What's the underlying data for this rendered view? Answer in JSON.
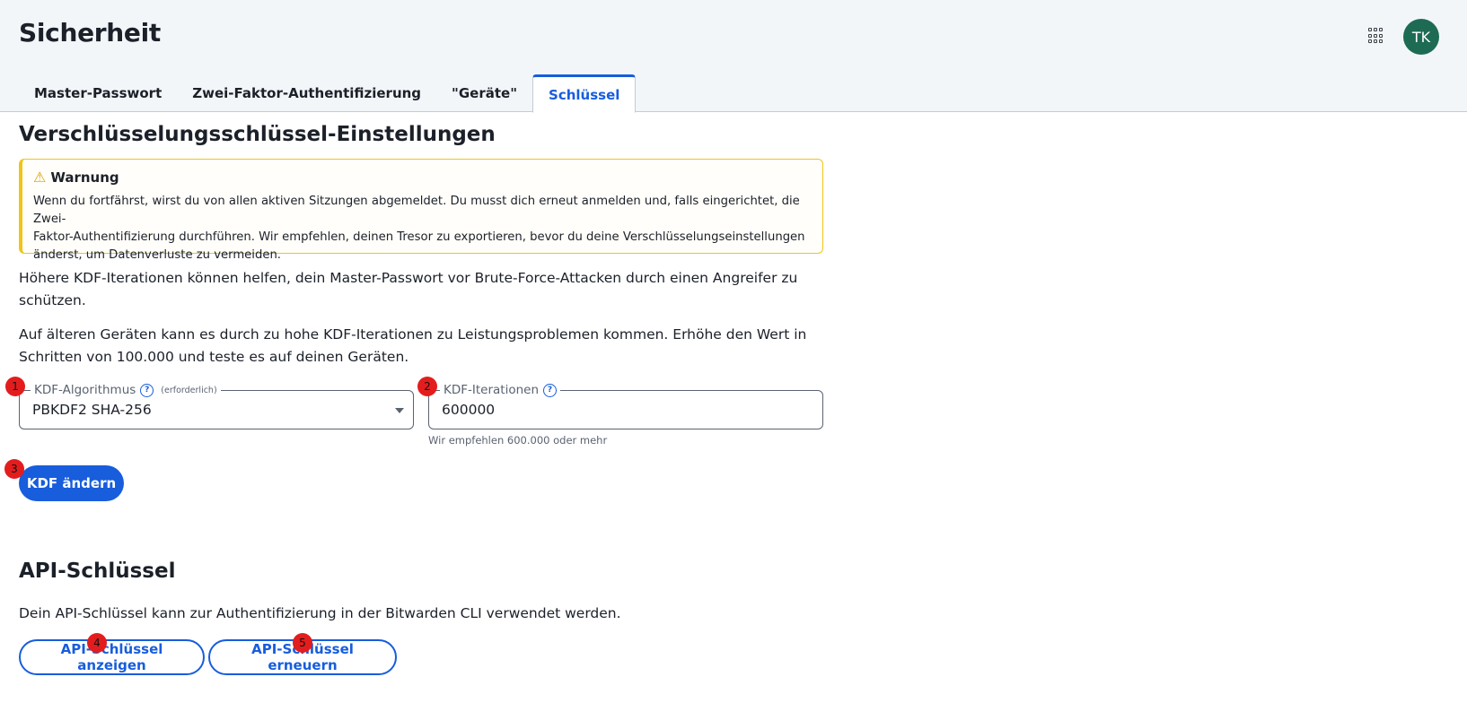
{
  "header": {
    "title": "Sicherheit",
    "apps_icon": "grid-icon",
    "avatar_initials": "TK",
    "avatar_color": "#1e6b53"
  },
  "tabs": [
    {
      "label": "Master-Passwort",
      "active": false
    },
    {
      "label": "Zwei-Faktor-Authentifizierung",
      "active": false
    },
    {
      "label": "\"Geräte\"",
      "active": false
    },
    {
      "label": "Schlüssel",
      "active": true
    }
  ],
  "encryption": {
    "title": "Verschlüsselungsschlüssel-Einstellungen",
    "warning": {
      "title": "Warnung",
      "icon": "warning-triangle-icon",
      "line1": "Wenn du fortfährst, wirst du von allen aktiven Sitzungen abgemeldet. Du musst dich erneut anmelden und, falls eingerichtet, die Zwei-",
      "line2": "Faktor-Authentifizierung durchführen. Wir empfehlen, deinen Tresor zu exportieren, bevor du deine Verschlüsselungseinstellungen",
      "line3": "änderst, um Datenverluste zu vermeiden."
    },
    "para1_line1": "Höhere KDF-Iterationen können helfen, dein Master-Passwort vor Brute-Force-Attacken durch einen Angreifer zu",
    "para1_line2": "schützen.",
    "para2_line1": "Auf älteren Geräten kann es durch zu hohe KDF-Iterationen zu Leistungsproblemen kommen. Erhöhe den Wert in",
    "para2_line2": "Schritten von 100.000 und teste es auf deinen Geräten.",
    "kdf_algorithm": {
      "label": "KDF-Algorithmus",
      "required": "(erforderlich)",
      "value": "PBKDF2 SHA-256"
    },
    "kdf_iterations": {
      "label": "KDF-Iterationen",
      "value": "600000",
      "hint": "Wir empfehlen 600.000 oder mehr"
    },
    "change_button": "KDF ändern"
  },
  "api": {
    "title": "API-Schlüssel",
    "description": "Dein API-Schlüssel kann zur Authentifizierung in der Bitwarden CLI verwendet werden.",
    "show_button": "API-Schlüssel anzeigen",
    "rotate_button": "API-Schlüssel erneuern"
  },
  "markers": [
    "1",
    "2",
    "3",
    "4",
    "5"
  ],
  "colors": {
    "accent": "#175ddc",
    "warning": "#f0c419",
    "marker": "#e31d1d"
  }
}
